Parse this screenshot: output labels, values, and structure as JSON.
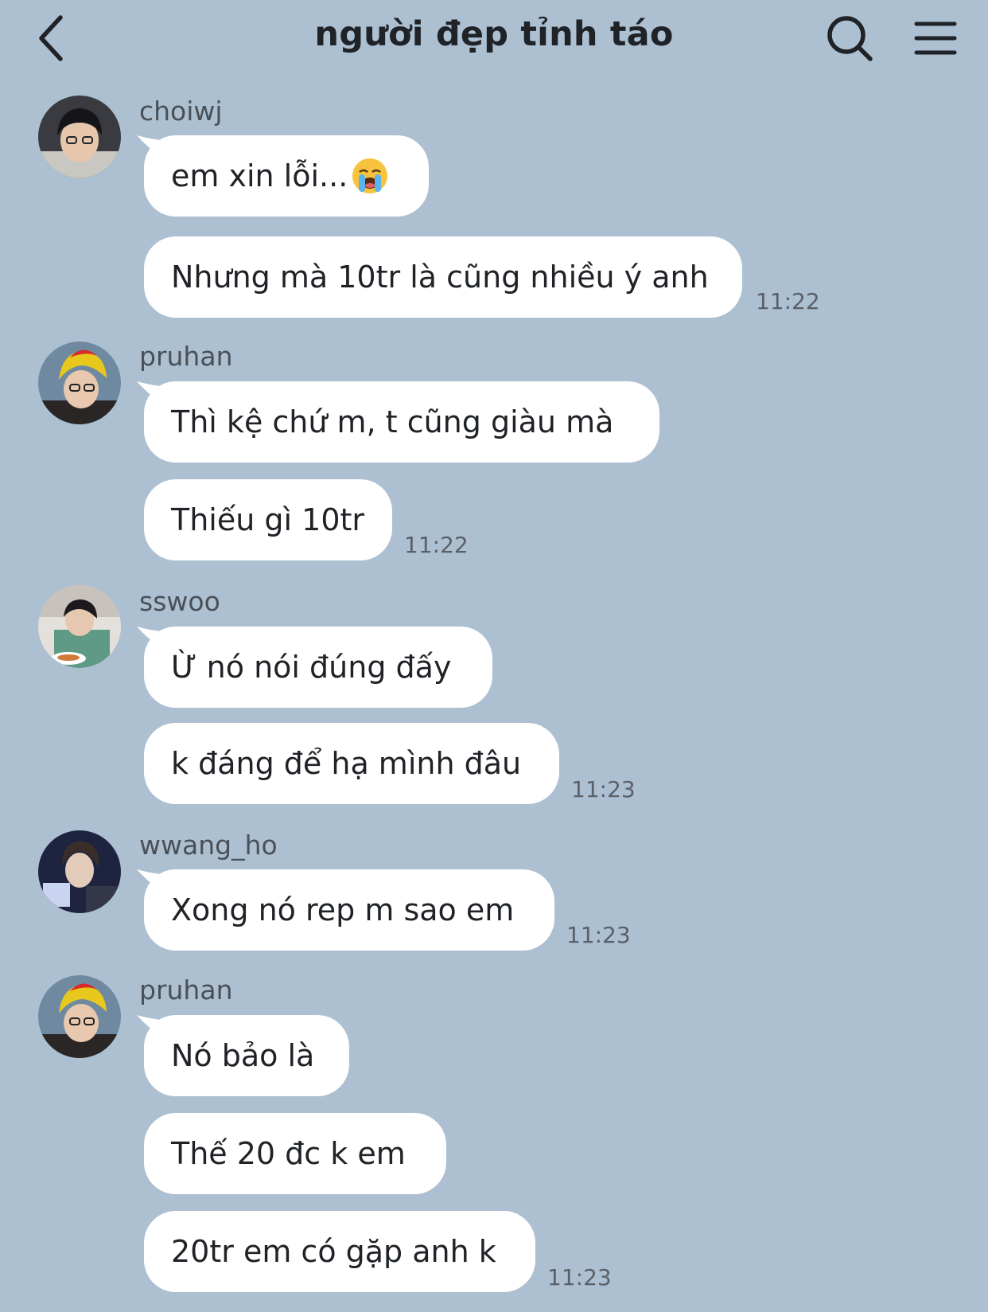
{
  "header": {
    "title": "người đẹp tỉnh táo",
    "back_icon": "chevron-left-icon",
    "search_icon": "search-icon",
    "menu_icon": "hamburger-menu-icon"
  },
  "colors": {
    "background": "#adc0d1",
    "bubble": "#ffffff",
    "text": "#1f2226",
    "muted": "#5a6068"
  },
  "messages": [
    {
      "sender": "choiwj",
      "bubbles": [
        {
          "text": "em xin lỗi...",
          "emoji": "loudly-crying-face"
        },
        {
          "text": "Nhưng mà 10tr là cũng nhiều ý anh",
          "time": "11:22"
        }
      ]
    },
    {
      "sender": "pruhan",
      "bubbles": [
        {
          "text": "Thì kệ chứ m, t cũng giàu mà"
        },
        {
          "text": "Thiếu gì 10tr",
          "time": "11:22"
        }
      ]
    },
    {
      "sender": "sswoo",
      "bubbles": [
        {
          "text": "Ừ nó nói đúng đấy"
        },
        {
          "text": "k đáng để hạ mình đâu",
          "time": "11:23"
        }
      ]
    },
    {
      "sender": "wwang_ho",
      "bubbles": [
        {
          "text": "Xong nó rep m sao em",
          "time": "11:23"
        }
      ]
    },
    {
      "sender": "pruhan",
      "bubbles": [
        {
          "text": "Nó bảo là"
        },
        {
          "text": "Thế 20 đc k em"
        },
        {
          "text": "20tr em có gặp anh k",
          "time": "11:23"
        }
      ]
    }
  ]
}
